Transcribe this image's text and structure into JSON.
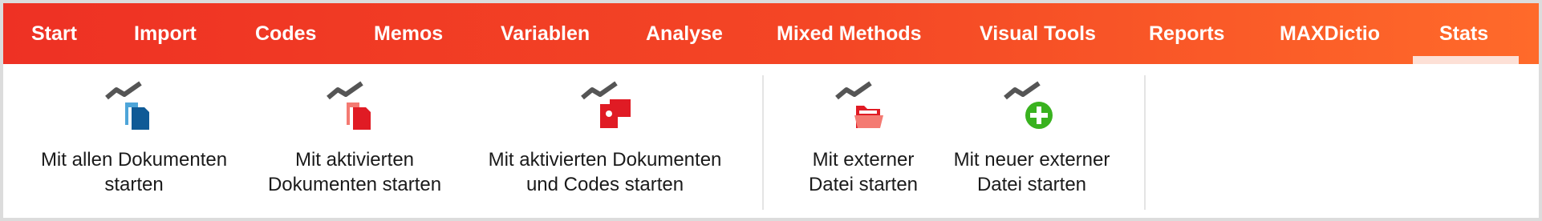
{
  "tabs": [
    {
      "label": "Start"
    },
    {
      "label": "Import"
    },
    {
      "label": "Codes"
    },
    {
      "label": "Memos"
    },
    {
      "label": "Variablen"
    },
    {
      "label": "Analyse"
    },
    {
      "label": "Mixed Methods"
    },
    {
      "label": "Visual Tools"
    },
    {
      "label": "Reports"
    },
    {
      "label": "MAXDictio"
    },
    {
      "label": "Stats"
    }
  ],
  "active_tab": "Stats",
  "ribbon": {
    "buttons": [
      {
        "line1": "Mit allen Dokumenten",
        "line2": "starten",
        "icon": "stats-all-documents-icon"
      },
      {
        "line1": "Mit aktivierten",
        "line2": "Dokumenten starten",
        "icon": "stats-activated-documents-icon"
      },
      {
        "line1": "Mit aktivierten Dokumenten",
        "line2": "und Codes starten",
        "icon": "stats-activated-documents-codes-icon"
      },
      {
        "line1": "Mit externer",
        "line2": "Datei starten",
        "icon": "stats-external-file-icon"
      },
      {
        "line1": "Mit neuer externer",
        "line2": "Datei starten",
        "icon": "stats-new-external-file-icon"
      }
    ]
  },
  "colors": {
    "tabbar_start": "#ee3124",
    "tabbar_end": "#ff6a2a",
    "active_indicator": "#fde0d6",
    "blue_dark": "#0f5a96",
    "blue_light": "#4ea5d9",
    "red": "#e01b24",
    "red_light": "#f47a72",
    "green": "#39b21f",
    "chart_line": "#555555"
  }
}
